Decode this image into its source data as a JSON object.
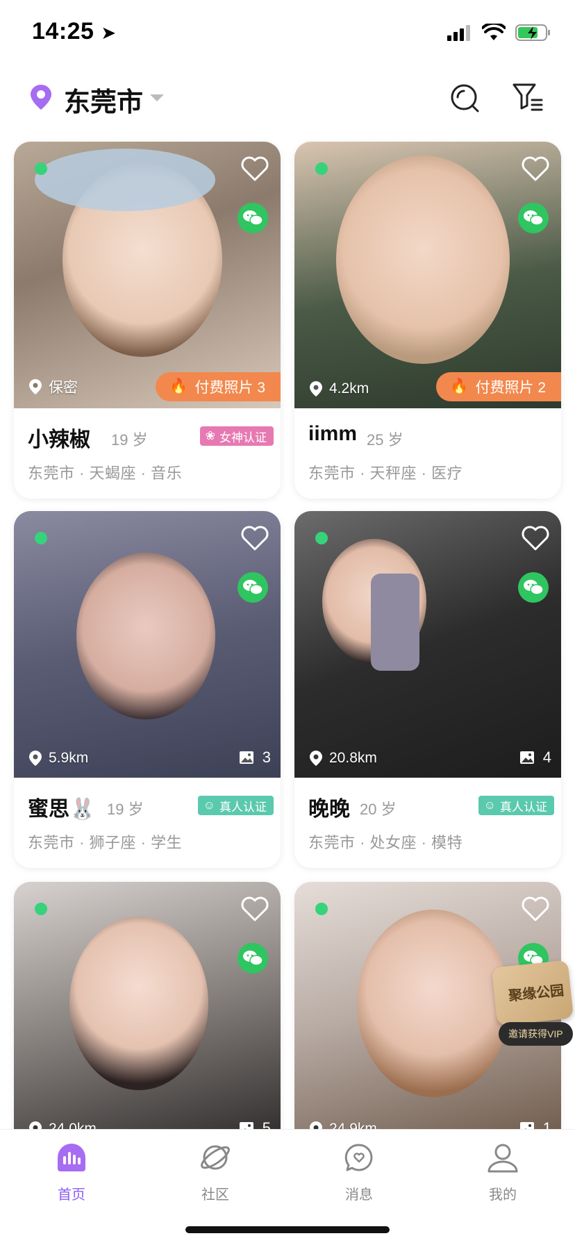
{
  "status": {
    "time": "14:25"
  },
  "header": {
    "city": "东莞市"
  },
  "cards": [
    {
      "name": "小辣椒",
      "age": "19 岁",
      "sub": "东莞市 · 天蝎座 · 音乐",
      "distance": "保密",
      "paid": "付费照片 3",
      "cert": "女神认证",
      "online": true,
      "has_wechat": true
    },
    {
      "name": "iimm",
      "age": "25 岁",
      "sub": "东莞市 · 天秤座 · 医疗",
      "distance": "4.2km",
      "paid": "付费照片 2",
      "online": true,
      "has_wechat": true
    },
    {
      "name": "蜜思🐰",
      "age": "19 岁",
      "sub": "东莞市 · 狮子座 · 学生",
      "distance": "5.9km",
      "photo_count": "3",
      "cert": "真人认证",
      "online": true,
      "has_wechat": true
    },
    {
      "name": "晚晚",
      "age": "20 岁",
      "sub": "东莞市 · 处女座 · 模特",
      "distance": "20.8km",
      "photo_count": "4",
      "cert": "真人认证",
      "online": true,
      "has_wechat": true
    },
    {
      "name": "",
      "age": "",
      "sub": "",
      "distance": "24.0km",
      "photo_count": "5",
      "online": true,
      "has_wechat": true
    },
    {
      "name": "",
      "age": "",
      "sub": "",
      "distance": "24.9km",
      "photo_count": "1",
      "online": true,
      "has_wechat": true
    }
  ],
  "vip": {
    "card_text": "聚缘公园",
    "pill": "邀请获得VIP"
  },
  "tabs": [
    {
      "label": "首页",
      "icon": "home-icon",
      "active": true
    },
    {
      "label": "社区",
      "icon": "planet-icon",
      "active": false
    },
    {
      "label": "消息",
      "icon": "message-icon",
      "active": false
    },
    {
      "label": "我的",
      "icon": "profile-icon",
      "active": false
    }
  ],
  "colors": {
    "accent": "#8b5cf6",
    "online": "#36d37a",
    "wechat": "#2fc560",
    "paid": "#f2884d",
    "cert_goddess": "#e779b2",
    "cert_real": "#5ac9ad"
  }
}
